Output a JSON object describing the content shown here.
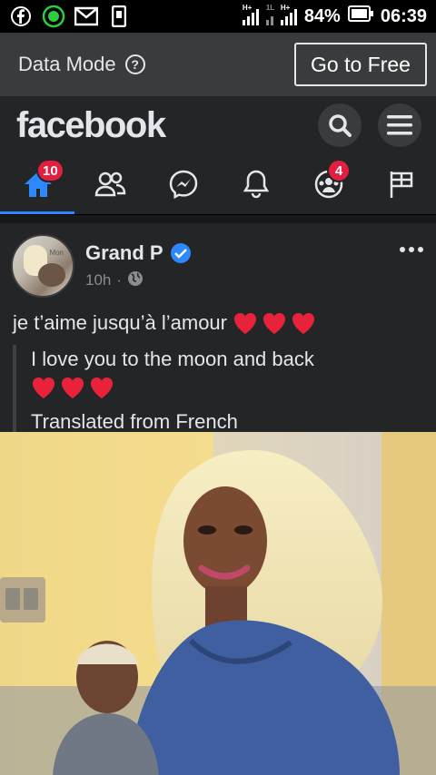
{
  "status_bar": {
    "icons": [
      "facebook-icon",
      "whatsapp-icon",
      "gmail-icon",
      "phone-icon"
    ],
    "network_1": "H+",
    "network_2": "1L",
    "network_3": "H+",
    "battery": "84%",
    "time": "06:39"
  },
  "data_mode": {
    "label": "Data Mode",
    "help": "?",
    "go_free": "Go to Free"
  },
  "header": {
    "logo": "facebook"
  },
  "nav": {
    "home_badge": "10",
    "groups_badge": "4"
  },
  "post": {
    "author": "Grand P",
    "time": "10h",
    "dot": "·",
    "avatar_text": "Mon",
    "text": "je t’aime jusqu’à l’amour",
    "translation": "I love you to the moon and back",
    "translated_from": "Translated from French"
  },
  "colors": {
    "accent": "#2d88ff",
    "badge": "#e41e3f",
    "heart": "#e8223b"
  }
}
